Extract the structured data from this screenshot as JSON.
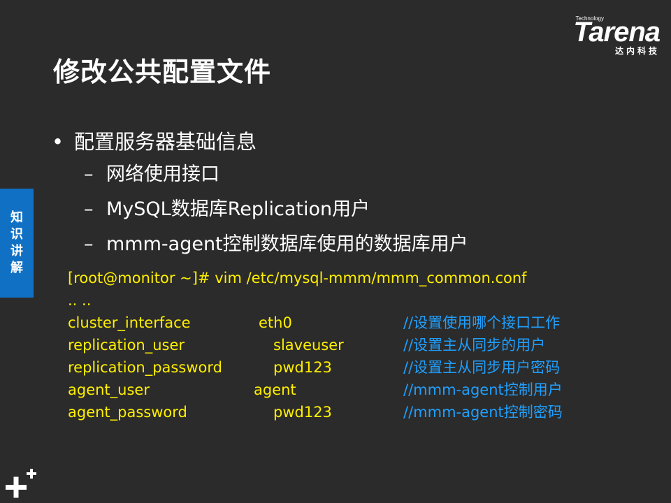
{
  "logo": {
    "technology": "Technology",
    "brand": "Tarena",
    "subtitle": "达内科技"
  },
  "title": "修改公共配置文件",
  "side_tab": {
    "chars": [
      "知",
      "识",
      "讲",
      "解"
    ]
  },
  "bullet": {
    "symbol": "•",
    "text": "配置服务器基础信息"
  },
  "sub_items": [
    {
      "dash": "–",
      "text": "网络使用接口"
    },
    {
      "dash": "–",
      "text": "MySQL数据库Replication用户"
    },
    {
      "dash": "–",
      "text": "mmm-agent控制数据库使用的数据库用户"
    }
  ],
  "code": {
    "command": "[root@monitor ~]# vim /etc/mysql-mmm/mmm_common.conf",
    "ellipsis": ".. .."
  },
  "config_rows": [
    {
      "key": "cluster_interface",
      "value": "eth0",
      "comment": "//设置使用哪个接口工作"
    },
    {
      "key": "replication_user",
      "value": "slaveuser",
      "comment": "//设置主从同步的用户"
    },
    {
      "key": "replication_password",
      "value": "pwd123",
      "comment": "//设置主从同步用户密码"
    },
    {
      "key": "agent_user",
      "value": "agent",
      "comment": "//mmm-agent控制用户"
    },
    {
      "key": "agent_password",
      "value": "pwd123",
      "comment": "//mmm-agent控制密码"
    }
  ],
  "colors": {
    "background": "#2b2b2b",
    "code": "#ffef00",
    "comment": "#1fa0ff",
    "tab": "#1070c4"
  },
  "icons": {
    "corner": "plus-icon"
  }
}
